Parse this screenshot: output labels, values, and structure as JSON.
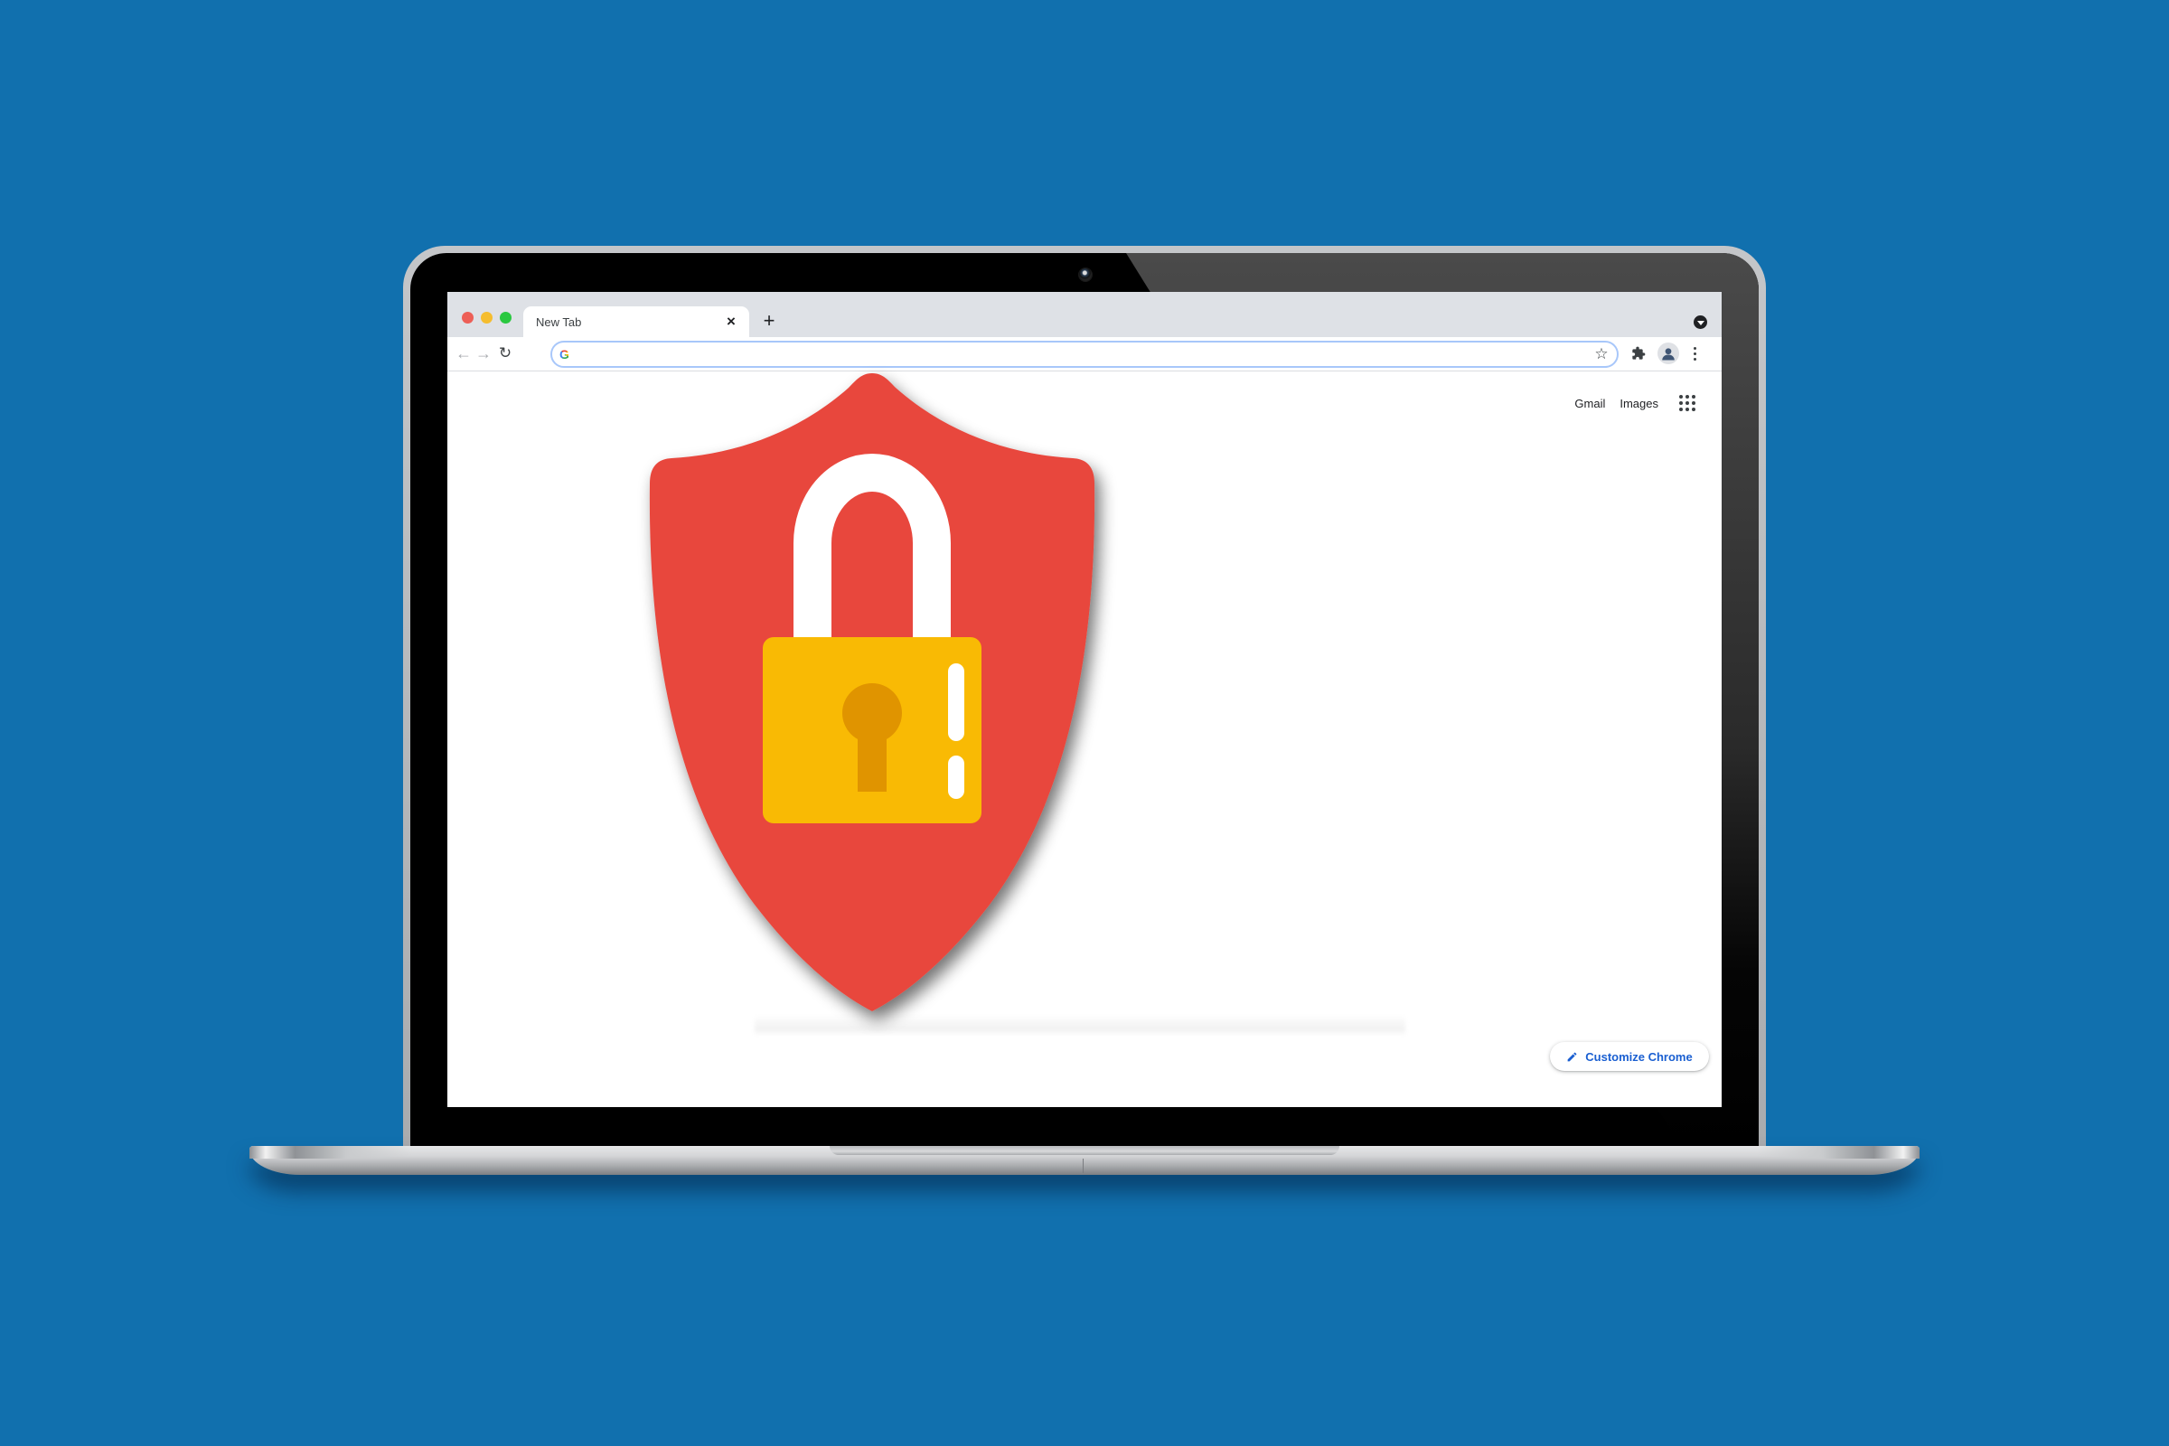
{
  "scene": {
    "background_color": "#1170ae",
    "device": "laptop"
  },
  "browser": {
    "window_controls": [
      {
        "name": "close",
        "color": "#ed5f57"
      },
      {
        "name": "minimize",
        "color": "#f5bd2f"
      },
      {
        "name": "maximize",
        "color": "#2ac840"
      }
    ],
    "tabs": [
      {
        "title": "New Tab",
        "close_icon": "×",
        "active": true
      }
    ],
    "new_tab_icon": "+",
    "toolbar": {
      "back_icon": "←",
      "forward_icon": "→",
      "reload_icon": "↻",
      "omnibox": {
        "value": "",
        "placeholder": "",
        "search_engine_icon": "G",
        "bookmark_icon": "☆"
      },
      "extensions_icon": "puzzle-piece",
      "profile_icon": "person",
      "menu_icon": "⋮"
    },
    "new_tab_page": {
      "links": [
        {
          "label": "Gmail"
        },
        {
          "label": "Images"
        }
      ],
      "apps_icon": "grid-9-dots",
      "customize_button": {
        "label": "Customize Chrome",
        "icon": "pencil",
        "color": "#1a5fd1"
      }
    }
  },
  "illustration": {
    "subject": "security shield with padlock",
    "shield_color": "#e8473e",
    "padlock_body_color": "#f9ba04",
    "keyhole_color": "#e09400",
    "shackle_color": "#ffffff"
  }
}
